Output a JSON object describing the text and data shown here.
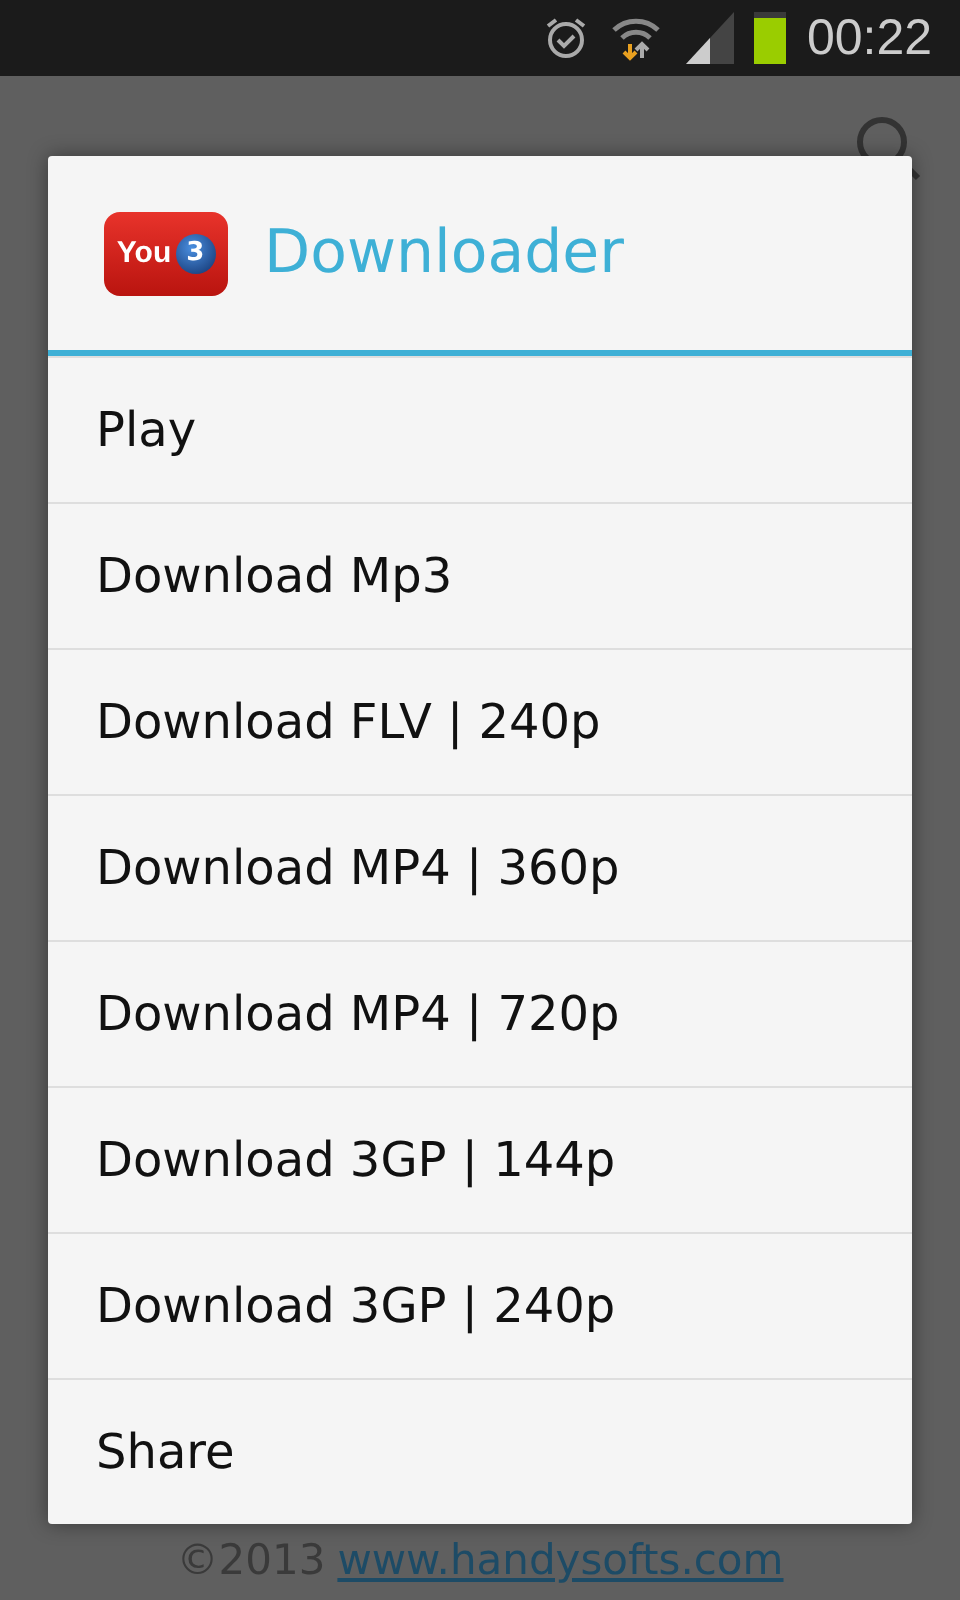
{
  "status_bar": {
    "time": "00:22"
  },
  "dialog": {
    "logo_text": "You",
    "logo_badge": "3",
    "title": "Downloader",
    "items": [
      {
        "label": "Play"
      },
      {
        "label": "Download Mp3"
      },
      {
        "label": "Download FLV | 240p"
      },
      {
        "label": "Download MP4 | 360p"
      },
      {
        "label": "Download MP4 | 720p"
      },
      {
        "label": "Download 3GP | 144p"
      },
      {
        "label": "Download 3GP | 240p"
      },
      {
        "label": "Share"
      }
    ]
  },
  "footer": {
    "copyright": "©2013",
    "link": "www.handysofts.com"
  }
}
